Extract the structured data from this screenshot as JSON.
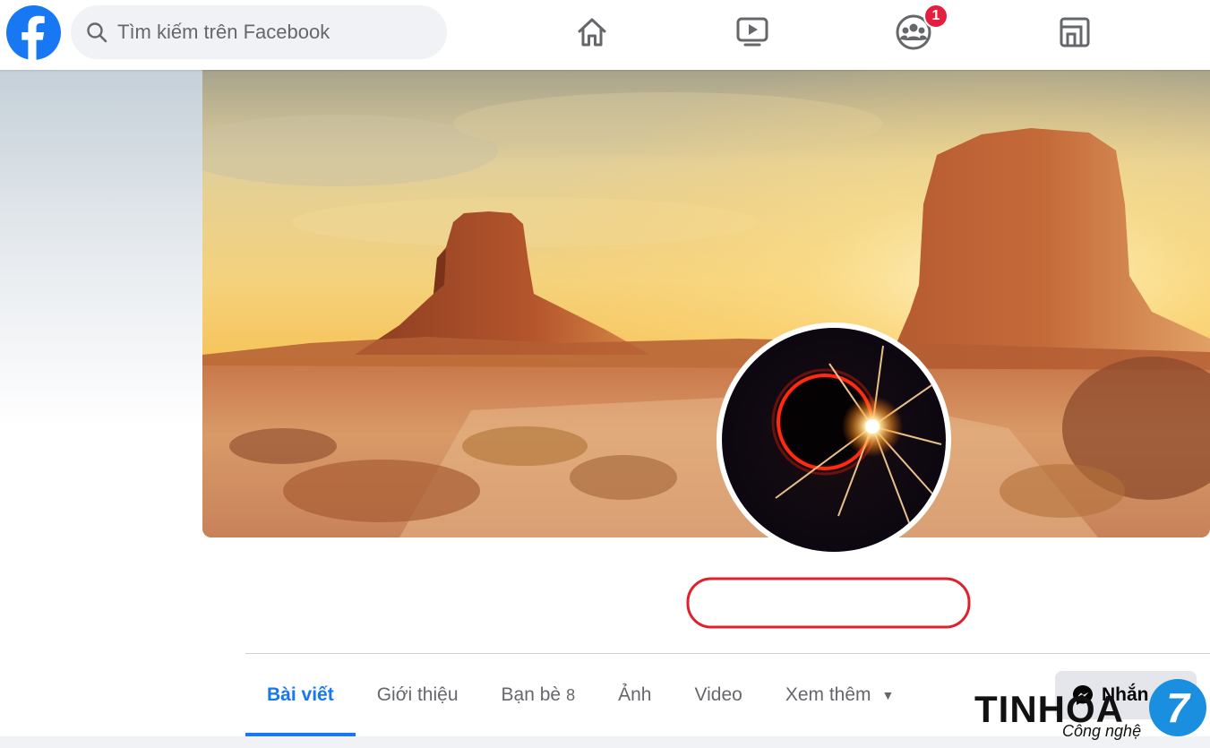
{
  "header": {
    "search_placeholder": "Tìm kiếm trên Facebook",
    "notification_badge": "1"
  },
  "profile": {
    "tabs": [
      {
        "label": "Bài viết",
        "active": true
      },
      {
        "label": "Giới thiệu"
      },
      {
        "label": "Bạn bè",
        "count": "8"
      },
      {
        "label": "Ảnh"
      },
      {
        "label": "Video"
      },
      {
        "label": "Xem thêm"
      }
    ],
    "message_button_label": "Nhắn"
  },
  "watermark": {
    "brand": "TINHOA",
    "tagline": "Công nghệ",
    "badge_number": "7"
  },
  "colors": {
    "brand_blue": "#1877f2",
    "badge_red": "#e41e3f",
    "highlight_oval_red": "#e0202a"
  }
}
